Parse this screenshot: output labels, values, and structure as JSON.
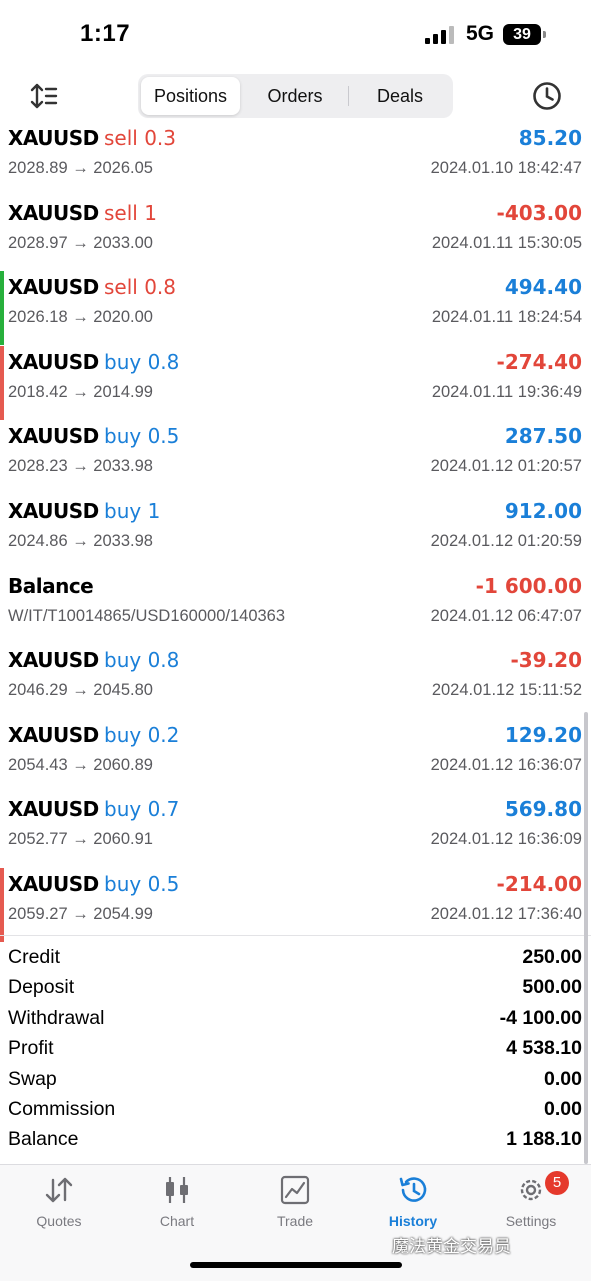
{
  "status": {
    "time": "1:17",
    "network": "5G",
    "battery": "39"
  },
  "toolbar": {
    "tabs": [
      "Positions",
      "Orders",
      "Deals"
    ],
    "active_tab": "Positions"
  },
  "deals": [
    {
      "symbol": "XAUUSD",
      "side": "sell 0.3",
      "side_color": "red",
      "profit": "85.20",
      "profit_color": "blue",
      "prices": "2028.89 → 2026.05",
      "time": "2024.01.10 18:42:47",
      "marker": ""
    },
    {
      "symbol": "XAUUSD",
      "side": "sell 1",
      "side_color": "red",
      "profit": "-403.00",
      "profit_color": "red",
      "prices": "2028.97 → 2033.00",
      "time": "2024.01.11 15:30:05",
      "marker": ""
    },
    {
      "symbol": "XAUUSD",
      "side": "sell 0.8",
      "side_color": "red",
      "profit": "494.40",
      "profit_color": "blue",
      "prices": "2026.18 → 2020.00",
      "time": "2024.01.11 18:24:54",
      "marker": "green"
    },
    {
      "symbol": "XAUUSD",
      "side": "buy 0.8",
      "side_color": "blue",
      "profit": "-274.40",
      "profit_color": "red",
      "prices": "2018.42 → 2014.99",
      "time": "2024.01.11 19:36:49",
      "marker": "red"
    },
    {
      "symbol": "XAUUSD",
      "side": "buy 0.5",
      "side_color": "blue",
      "profit": "287.50",
      "profit_color": "blue",
      "prices": "2028.23 → 2033.98",
      "time": "2024.01.12 01:20:57",
      "marker": ""
    },
    {
      "symbol": "XAUUSD",
      "side": "buy 1",
      "side_color": "blue",
      "profit": "912.00",
      "profit_color": "blue",
      "prices": "2024.86 → 2033.98",
      "time": "2024.01.12 01:20:59",
      "marker": ""
    },
    {
      "symbol": "Balance",
      "side": "",
      "side_color": "blue",
      "profit": "-1 600.00",
      "profit_color": "red",
      "prices": "W/IT/T10014865/USD160000/140363",
      "time": "2024.01.12 06:47:07",
      "marker": ""
    },
    {
      "symbol": "XAUUSD",
      "side": "buy 0.8",
      "side_color": "blue",
      "profit": "-39.20",
      "profit_color": "red",
      "prices": "2046.29 → 2045.80",
      "time": "2024.01.12 15:11:52",
      "marker": ""
    },
    {
      "symbol": "XAUUSD",
      "side": "buy 0.2",
      "side_color": "blue",
      "profit": "129.20",
      "profit_color": "blue",
      "prices": "2054.43 → 2060.89",
      "time": "2024.01.12 16:36:07",
      "marker": ""
    },
    {
      "symbol": "XAUUSD",
      "side": "buy 0.7",
      "side_color": "blue",
      "profit": "569.80",
      "profit_color": "blue",
      "prices": "2052.77 → 2060.91",
      "time": "2024.01.12 16:36:09",
      "marker": ""
    },
    {
      "symbol": "XAUUSD",
      "side": "buy 0.5",
      "side_color": "blue",
      "profit": "-214.00",
      "profit_color": "red",
      "prices": "2059.27 → 2054.99",
      "time": "2024.01.12 17:36:40",
      "marker": "red"
    }
  ],
  "summary": [
    {
      "label": "Credit",
      "value": "250.00"
    },
    {
      "label": "Deposit",
      "value": "500.00"
    },
    {
      "label": "Withdrawal",
      "value": "-4 100.00"
    },
    {
      "label": "Profit",
      "value": "4 538.10"
    },
    {
      "label": "Swap",
      "value": "0.00"
    },
    {
      "label": "Commission",
      "value": "0.00"
    },
    {
      "label": "Balance",
      "value": "1 188.10"
    }
  ],
  "tabbar": {
    "items": [
      {
        "label": "Quotes",
        "icon": "quotes-icon"
      },
      {
        "label": "Chart",
        "icon": "chart-icon"
      },
      {
        "label": "Trade",
        "icon": "trade-icon"
      },
      {
        "label": "History",
        "icon": "history-icon"
      },
      {
        "label": "Settings",
        "icon": "settings-icon"
      }
    ],
    "active": "History",
    "settings_badge": "5"
  },
  "watermark": "魔法黄金交易员",
  "colors": {
    "accent": "#1a7fd8",
    "negative": "#e2463a",
    "marker_green": "#27b03c",
    "marker_red": "#e55a50"
  }
}
